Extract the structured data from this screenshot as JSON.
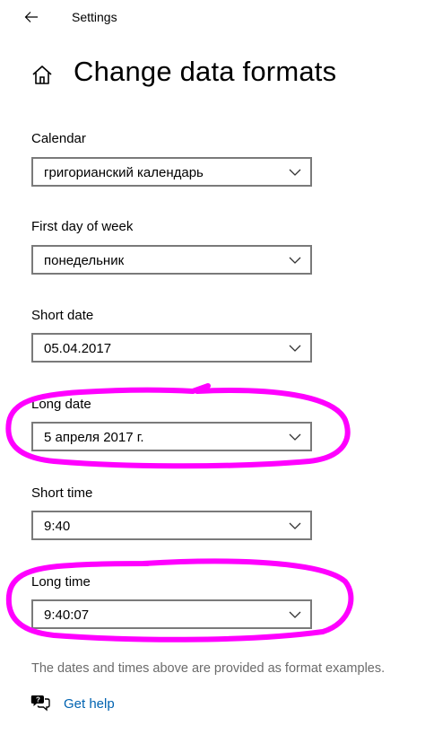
{
  "titlebar": {
    "title": "Settings",
    "back_icon": "arrow-left-icon"
  },
  "page": {
    "title": "Change data formats",
    "icon": "home-icon"
  },
  "fields": [
    {
      "label": "Calendar",
      "value": "григорианский календарь"
    },
    {
      "label": "First day of week",
      "value": "понедельник"
    },
    {
      "label": "Short date",
      "value": "05.04.2017"
    },
    {
      "label": "Long date",
      "value": "5 апреля 2017 г."
    },
    {
      "label": "Short time",
      "value": "9:40"
    },
    {
      "label": "Long time",
      "value": "9:40:07"
    }
  ],
  "note": "The dates and times above are provided as format examples.",
  "help": {
    "label": "Get help",
    "icon": "chat-help-icon"
  },
  "colors": {
    "link": "#0063b1",
    "annotation": "#ff00ff",
    "combo_border": "#7a7a7a",
    "note_text": "#6b6b6b"
  }
}
